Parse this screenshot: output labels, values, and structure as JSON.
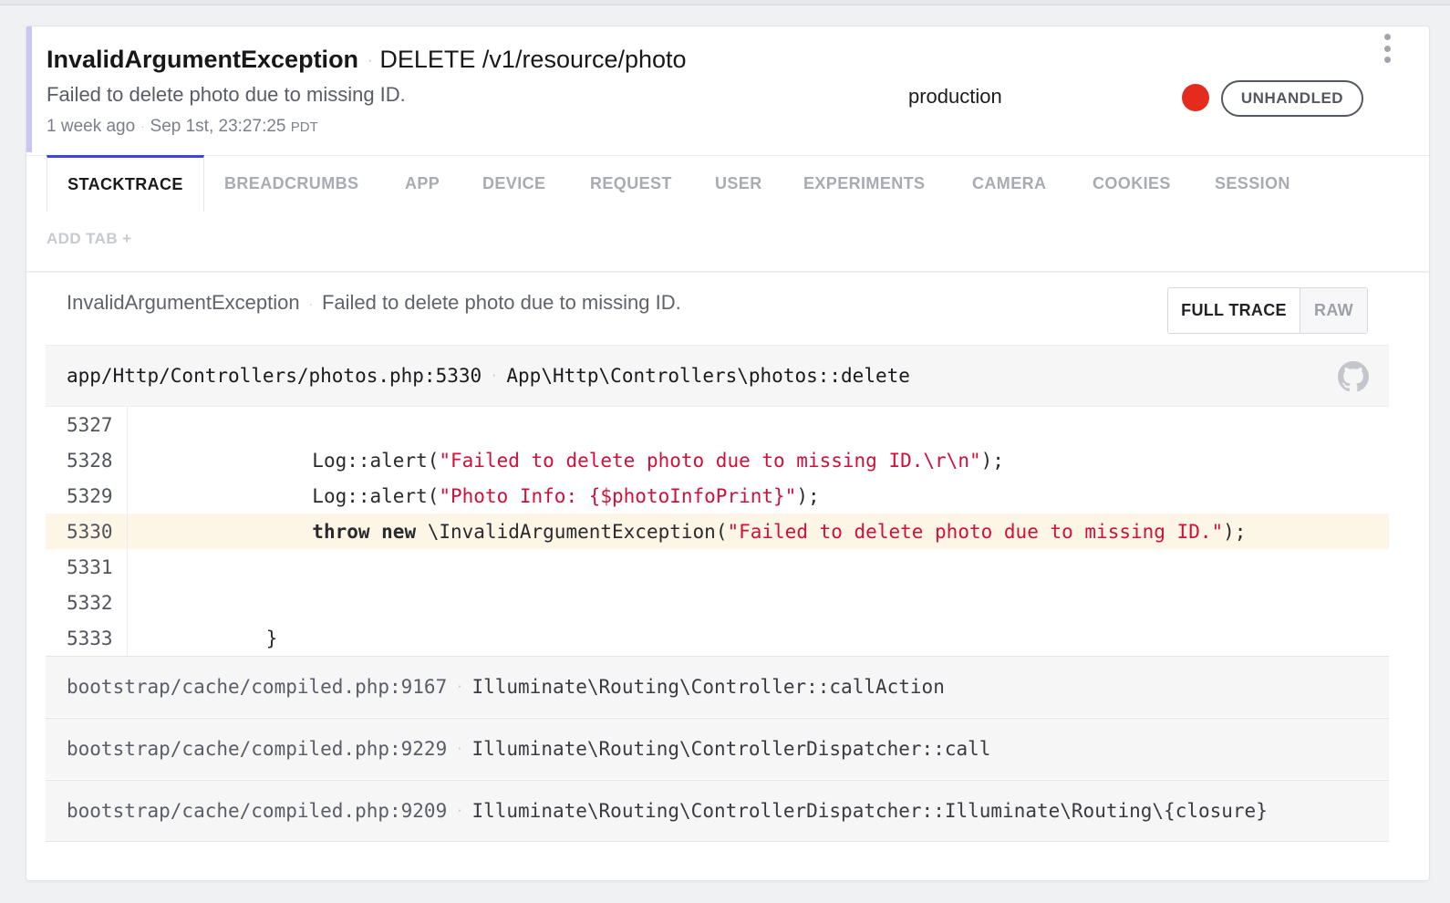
{
  "header": {
    "exception_class": "InvalidArgumentException",
    "request": "DELETE /v1/resource/photo",
    "message": "Failed to delete photo due to missing ID.",
    "relative_time": "1 week ago",
    "timestamp": "Sep 1st, 23:27:25",
    "timezone": "PDT",
    "release_stage": "production",
    "severity_color": "#e42b1e",
    "badge": "UNHANDLED",
    "menu_icon": "vertical-dots-icon"
  },
  "tabs": [
    {
      "label": "STACKTRACE",
      "active": true
    },
    {
      "label": "BREADCRUMBS"
    },
    {
      "label": "APP"
    },
    {
      "label": "DEVICE"
    },
    {
      "label": "REQUEST"
    },
    {
      "label": "USER"
    },
    {
      "label": "EXPERIMENTS"
    },
    {
      "label": "CAMERA"
    },
    {
      "label": "COOKIES"
    },
    {
      "label": "SESSION"
    }
  ],
  "add_tab_label": "ADD TAB +",
  "stacktrace": {
    "exception_class": "InvalidArgumentException",
    "message": "Failed to delete photo due to missing ID.",
    "toggle": {
      "full_label": "FULL TRACE",
      "raw_label": "RAW"
    },
    "top_frame": {
      "file": "app/Http/Controllers/photos.php:5330",
      "method": "App\\Http\\Controllers\\photos::delete",
      "icon": "github-icon"
    },
    "code_lines": [
      {
        "number": "5327",
        "code": ""
      },
      {
        "number": "5328",
        "indent": "                ",
        "pre": "Log::alert(",
        "str": "\"Failed to delete photo due to missing ID.\\r\\n\"",
        "post": ");"
      },
      {
        "number": "5329",
        "indent": "                ",
        "pre": "Log::alert(",
        "str": "\"Photo Info: {$photoInfoPrint}\"",
        "post": ");"
      },
      {
        "number": "5330",
        "indent": "                ",
        "kw": "throw new",
        "pre": " \\InvalidArgumentException(",
        "str": "\"Failed to delete photo due to missing ID.\"",
        "post": ");",
        "highlight": true
      },
      {
        "number": "5331",
        "code": ""
      },
      {
        "number": "5332",
        "code": ""
      },
      {
        "number": "5333",
        "indent": "            ",
        "pre": "}"
      }
    ],
    "frames": [
      {
        "file": "bootstrap/cache/compiled.php:9167",
        "method": "Illuminate\\Routing\\Controller::callAction"
      },
      {
        "file": "bootstrap/cache/compiled.php:9229",
        "method": "Illuminate\\Routing\\ControllerDispatcher::call"
      },
      {
        "file": "bootstrap/cache/compiled.php:9209",
        "method": "Illuminate\\Routing\\ControllerDispatcher::Illuminate\\Routing\\{closure}"
      }
    ]
  }
}
